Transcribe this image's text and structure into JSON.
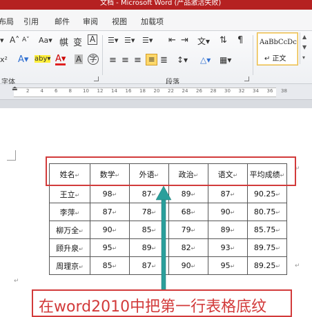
{
  "title": "文档 - Microsoft Word (产品激活失败)",
  "tabs": [
    "布局",
    "引用",
    "邮件",
    "审阅",
    "视图",
    "加载项"
  ],
  "ribbon": {
    "font_group_label": "字体",
    "paragraph_group_label": "段落",
    "grow_font": "A˄",
    "shrink_font": "A˅",
    "change_case": "Aa▾",
    "clear_format": "帺",
    "phonetic": "变",
    "char_border": "A",
    "subscript_label": "x²",
    "text_effect": "A▾",
    "highlight": "aby▾",
    "font_color": "A▾",
    "char_shading": "A",
    "enclose_char": "字",
    "bullets": "☰▾",
    "numbering": "☰▾",
    "multilevel": "☰▾",
    "decrease_indent": "⇤",
    "increase_indent": "⇥",
    "asian_layout": "文▾",
    "sort": "⇅",
    "show_marks": "¶",
    "line_spacing": "↕▾",
    "shading": "△▾",
    "borders": "▦▾",
    "styles_preview": "AaBbCcDc",
    "style_normal": "↵ 正文"
  },
  "ruler_ticks": [
    "2",
    "4",
    "6",
    "8",
    "10",
    "12",
    "14",
    "16",
    "18",
    "20",
    "22",
    "24",
    "26",
    "28",
    "30",
    "32",
    "34",
    "36",
    "38"
  ],
  "table": {
    "headers": [
      "姓名",
      "数学",
      "外语",
      "政治",
      "语文",
      "平均成绩"
    ],
    "rows": [
      [
        "王立",
        "98",
        "87",
        "89",
        "87",
        "90.25"
      ],
      [
        "李萍",
        "87",
        "78",
        "68",
        "90",
        "80.75"
      ],
      [
        "柳万全",
        "90",
        "85",
        "79",
        "89",
        "85.75"
      ],
      [
        "顾升泉",
        "95",
        "89",
        "82",
        "93",
        "89.75"
      ],
      [
        "周理京",
        "85",
        "87",
        "90",
        "95",
        "89.25"
      ]
    ],
    "cell_mark": "↵"
  },
  "caption": "在word2010中把第一行表格底纹",
  "colors": {
    "accent_red": "#d23a3a",
    "arrow_teal": "#2a9f9b",
    "titlebar": "#b52121"
  }
}
